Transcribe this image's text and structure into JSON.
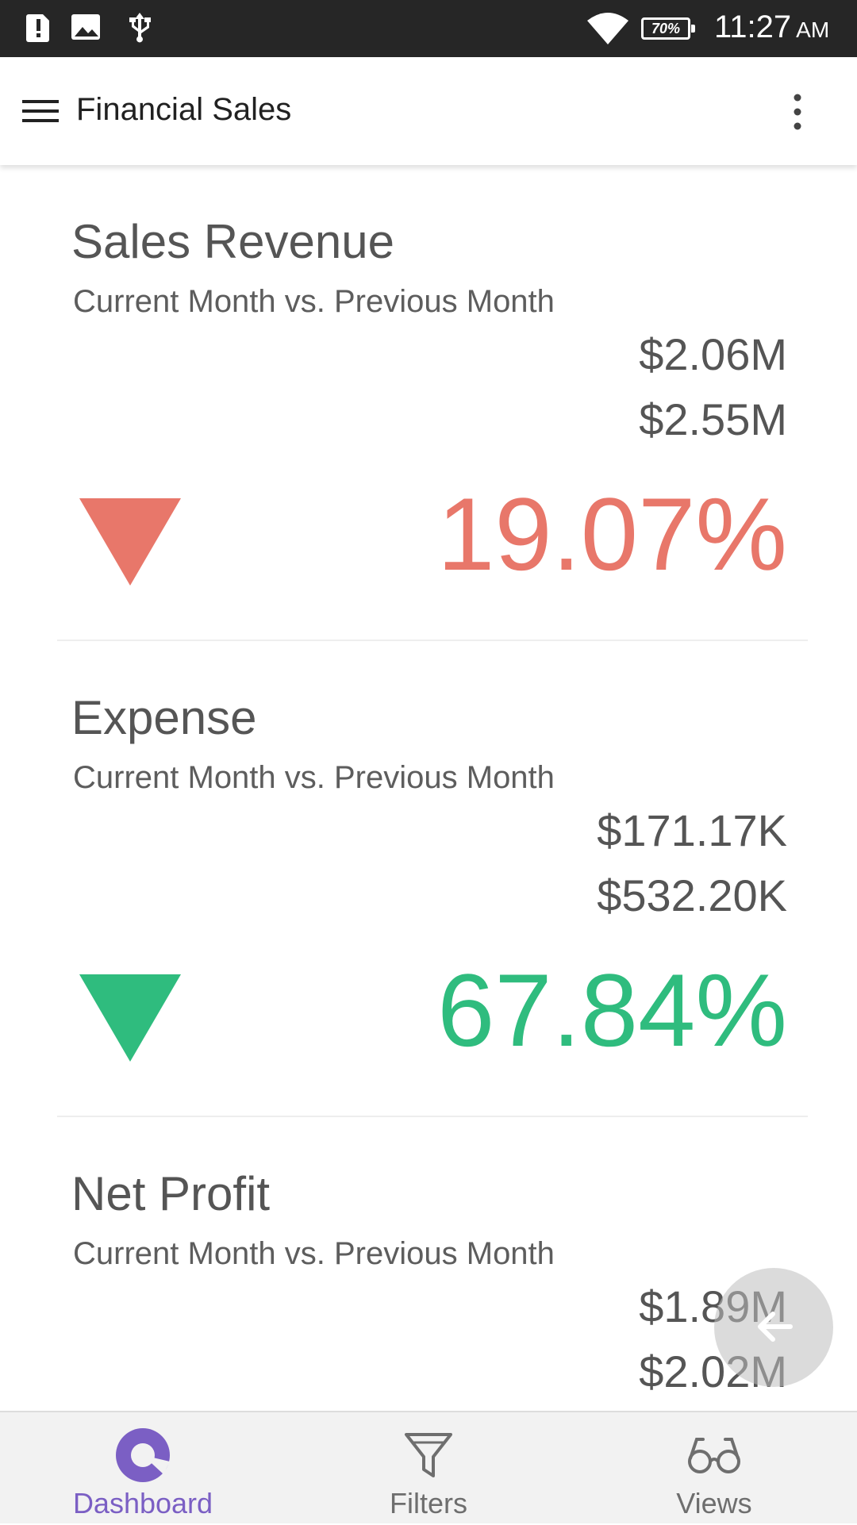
{
  "status_bar": {
    "battery": "70%",
    "time": "11:27",
    "ampm": "AM",
    "icons": [
      "alert-icon",
      "image-icon",
      "usb-icon",
      "wifi-icon",
      "battery-icon"
    ]
  },
  "app_bar": {
    "title": "Financial Sales",
    "icons": [
      "menu-icon",
      "more-vert-icon"
    ]
  },
  "cards": [
    {
      "title": "Sales Revenue",
      "subtitle": "Current Month vs. Previous Month",
      "current": "$2.06M",
      "previous": "$2.55M",
      "percent": "19.07%",
      "trend": "down",
      "status_color": "#e8776a"
    },
    {
      "title": "Expense",
      "subtitle": "Current Month vs. Previous Month",
      "current": "$171.17K",
      "previous": "$532.20K",
      "percent": "67.84%",
      "trend": "down",
      "status_color": "#2fbc7e"
    },
    {
      "title": "Net Profit",
      "subtitle": "Current Month vs. Previous Month",
      "current": "$1.89M",
      "previous": "$2.02M"
    }
  ],
  "fab": {
    "icon": "back-arrow-icon"
  },
  "bottom_nav": {
    "tabs": [
      {
        "label": "Dashboard",
        "icon": "dashboard-icon",
        "active": true
      },
      {
        "label": "Filters",
        "icon": "filter-icon",
        "active": false
      },
      {
        "label": "Views",
        "icon": "glasses-icon",
        "active": false
      }
    ],
    "active_color": "#7b5fc4",
    "inactive_color": "#6e6e6e"
  }
}
